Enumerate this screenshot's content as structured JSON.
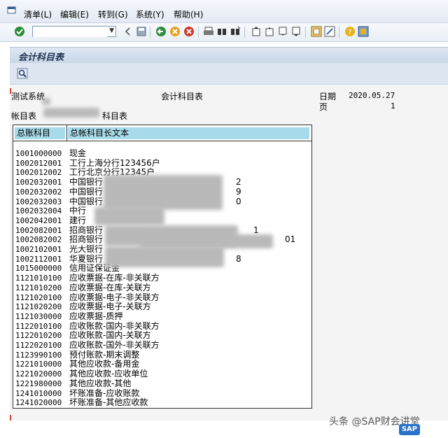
{
  "menu": [
    "清单(L)",
    "编辑(E)",
    "转到(G)",
    "系统(Y)",
    "帮助(H)"
  ],
  "window_title": "会计科目表",
  "report_header": {
    "system": "测试系统",
    "title": "会计科目表",
    "date_label": "日期",
    "date_value": "2020.05.27",
    "page_label": "页",
    "page_value": "1",
    "coa_prefix": "帐目表",
    "coa_suffix": "科目表"
  },
  "table": {
    "columns": [
      "总账科目",
      "总帐科目长文本"
    ],
    "rows": [
      {
        "no": "1001000000",
        "text": "现金"
      },
      {
        "no": "1002012001",
        "text": "工行上海分行123456户"
      },
      {
        "no": "1002012002",
        "text": "工行北京分行12345户"
      },
      {
        "no": "1002032001",
        "text": "中国银行",
        "tail": "2"
      },
      {
        "no": "1002032002",
        "text": "中国银行",
        "tail": "9"
      },
      {
        "no": "1002032003",
        "text": "中国银行",
        "tail": "0"
      },
      {
        "no": "1002032004",
        "text": "中行"
      },
      {
        "no": "1002042001",
        "text": "建行"
      },
      {
        "no": "1002082001",
        "text": "招商银行",
        "tail": "1"
      },
      {
        "no": "1002082002",
        "text": "招商银行",
        "tail": "01"
      },
      {
        "no": "1002102001",
        "text": "光大银行"
      },
      {
        "no": "1002112001",
        "text": "华夏银行",
        "tail": "8"
      },
      {
        "no": "1015000000",
        "text": "信用证保证金"
      },
      {
        "no": "1121010100",
        "text": "应收票据-在库-非关联方"
      },
      {
        "no": "1121010200",
        "text": "应收票据-在库-关联方"
      },
      {
        "no": "1121020100",
        "text": "应收票据-电子-非关联方"
      },
      {
        "no": "1121020200",
        "text": "应收票据-电子-关联方"
      },
      {
        "no": "1121030000",
        "text": "应收票据-质押"
      },
      {
        "no": "1122010100",
        "text": "应收账款-国内-非关联方"
      },
      {
        "no": "1122010200",
        "text": "应收账款-国内-关联方"
      },
      {
        "no": "1122020100",
        "text": "应收账款-国外-非关联方"
      },
      {
        "no": "1123990100",
        "text": "预付账款-期末调整"
      },
      {
        "no": "1221010000",
        "text": "其他应收款-备用金"
      },
      {
        "no": "1221020000",
        "text": "其他应收款-应收单位"
      },
      {
        "no": "1221980000",
        "text": "其他应收款-其他"
      },
      {
        "no": "1241010000",
        "text": "坏账准备-应收账款"
      },
      {
        "no": "1241020000",
        "text": "坏账准备-其他应收款"
      }
    ]
  },
  "watermark": "头条 @SAP财会讲堂",
  "sap_logo": "SAP",
  "colors": {
    "header_cell": "#a8dbea",
    "title_text": "#1f3350"
  }
}
